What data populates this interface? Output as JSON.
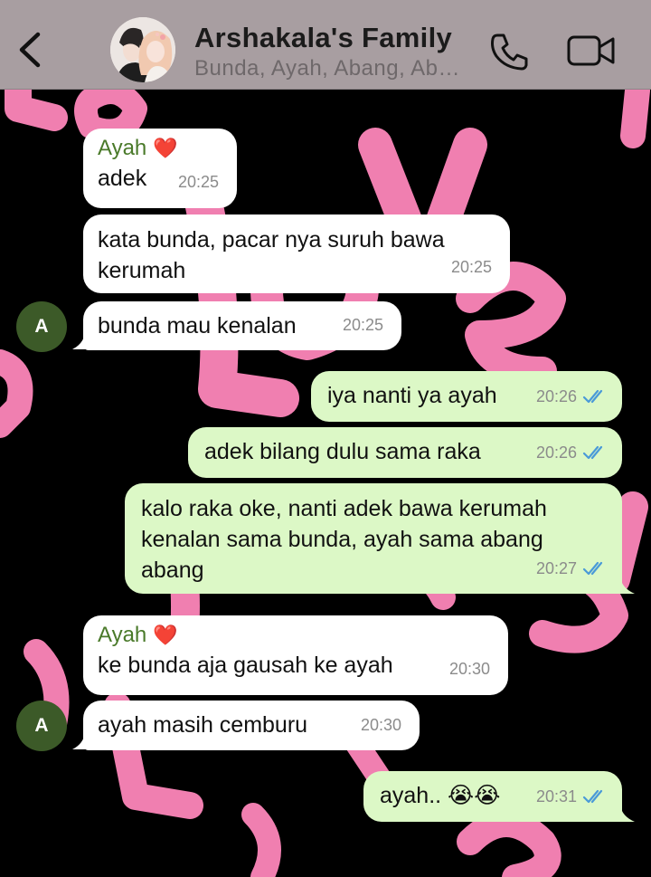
{
  "header": {
    "title": "Arshakala's Family",
    "subtitle": "Bunda, Ayah, Abang, Ab…",
    "icons": [
      "back-chevron-icon",
      "group-avatar-photo",
      "phone-icon",
      "video-camera-icon"
    ]
  },
  "avatar_initial": "A",
  "messages": [
    {
      "dir": "in",
      "sender": "Ayah",
      "heart": "❤️",
      "text": "adek",
      "time": "20:25"
    },
    {
      "dir": "in",
      "text": "kata bunda, pacar nya suruh bawa\nkerumah",
      "time": "20:25"
    },
    {
      "dir": "in",
      "text": "bunda mau kenalan",
      "time": "20:25"
    },
    {
      "dir": "out",
      "text": "iya nanti ya ayah",
      "time": "20:26"
    },
    {
      "dir": "out",
      "text": "adek bilang dulu sama raka",
      "time": "20:26"
    },
    {
      "dir": "out",
      "text": "kalo raka oke, nanti adek bawa kerumah\nkenalan sama bunda, ayah sama abang\nabang",
      "time": "20:27"
    },
    {
      "dir": "in",
      "sender": "Ayah",
      "heart": "❤️",
      "text": "ke bunda aja gausah ke ayah",
      "time": "20:30"
    },
    {
      "dir": "in",
      "text": "ayah masih cemburu",
      "time": "20:30"
    },
    {
      "dir": "out",
      "text": "ayah.. 😭😭",
      "time": "20:31"
    }
  ],
  "colors": {
    "header_bg": "#a89ea1",
    "incoming_bubble": "#ffffff",
    "outgoing_bubble": "#dcf8c6",
    "sender_name": "#4a7a2a",
    "read_ticks": "#4a9ad8",
    "avatar_bg": "#3c5a28",
    "wallpaper_pink": "#f07fb0"
  }
}
